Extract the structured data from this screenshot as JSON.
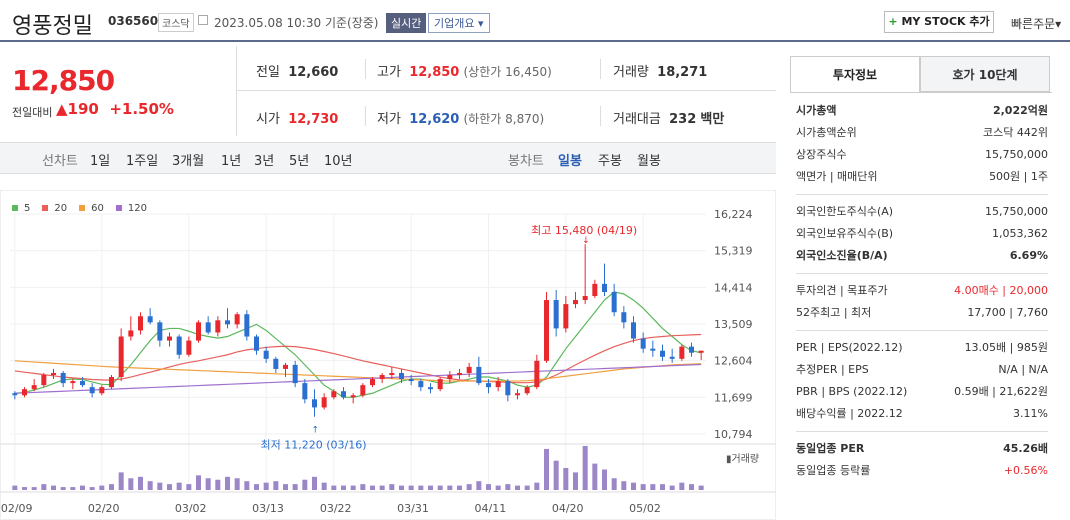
{
  "header": {
    "stock_name": "영풍정밀",
    "stock_code": "036560",
    "market_badge": "코스닥",
    "datetime": "2023.05.08 10:30",
    "basis": "기준(장중)",
    "realtime_label": "실시간",
    "company_overview": "기업개요",
    "my_stock": "MY STOCK 추가",
    "quick_order": "빠른주문"
  },
  "price": {
    "current": "12,850",
    "change_label": "전일대비",
    "change_value": "190",
    "change_pct": "+1.50%",
    "color_up": "#e8282c",
    "color_down": "#2b5fb4"
  },
  "stats": {
    "prev_label": "전일",
    "prev": "12,660",
    "high_label": "고가",
    "high": "12,850",
    "upper_limit": "(상한가 16,450)",
    "volume_label": "거래량",
    "volume": "18,271",
    "open_label": "시가",
    "open": "12,730",
    "low_label": "저가",
    "low": "12,620",
    "lower_limit": "(하한가 8,870)",
    "amount_label": "거래대금",
    "amount": "232",
    "amount_unit": "백만"
  },
  "chart_tabs": {
    "line": "선차트",
    "periods": [
      "1일",
      "1주일",
      "3개월",
      "1년",
      "3년",
      "5년",
      "10년"
    ],
    "candle": "봉차트",
    "candle_periods": [
      "일봉",
      "주봉",
      "월봉"
    ],
    "selected": "일봉"
  },
  "legend": [
    {
      "label": "5",
      "color": "#5cb85c"
    },
    {
      "label": "20",
      "color": "#e8605c"
    },
    {
      "label": "60",
      "color": "#f0a040"
    },
    {
      "label": "120",
      "color": "#a070d0"
    }
  ],
  "annotations": {
    "high": "최고 15,480 (04/19)",
    "low": "최저 11,220 (03/16)",
    "volume_label": "거래량"
  },
  "chart_data": {
    "type": "candlestick",
    "y_ticks": [
      "16,224",
      "15,319",
      "14,414",
      "13,509",
      "12,604",
      "11,699",
      "10,794"
    ],
    "ylim": [
      10794,
      16224
    ],
    "x_ticks": [
      "02/09",
      "02/20",
      "03/02",
      "03/13",
      "03/22",
      "03/31",
      "04/11",
      "04/20",
      "05/02"
    ],
    "candles": [
      [
        11800,
        11850,
        11650,
        11750
      ],
      [
        11750,
        11950,
        11700,
        11900
      ],
      [
        11900,
        12150,
        11850,
        12000
      ],
      [
        12000,
        12300,
        11950,
        12250
      ],
      [
        12250,
        12400,
        12150,
        12300
      ],
      [
        12300,
        12350,
        11950,
        12050
      ],
      [
        12050,
        12150,
        11900,
        12100
      ],
      [
        12100,
        12200,
        11950,
        12000
      ],
      [
        11950,
        12050,
        11700,
        11800
      ],
      [
        11800,
        12000,
        11750,
        11950
      ],
      [
        11950,
        12250,
        11900,
        12200
      ],
      [
        12200,
        13400,
        12100,
        13200
      ],
      [
        13200,
        13700,
        13100,
        13350
      ],
      [
        13350,
        13800,
        13250,
        13700
      ],
      [
        13700,
        13900,
        13500,
        13550
      ],
      [
        13550,
        13600,
        12950,
        13100
      ],
      [
        13100,
        13300,
        12950,
        13200
      ],
      [
        13200,
        13250,
        12650,
        12750
      ],
      [
        12750,
        13200,
        12700,
        13100
      ],
      [
        13100,
        13600,
        13050,
        13550
      ],
      [
        13550,
        13700,
        13250,
        13300
      ],
      [
        13300,
        13700,
        13200,
        13600
      ],
      [
        13600,
        13900,
        13400,
        13500
      ],
      [
        13500,
        13800,
        13400,
        13750
      ],
      [
        13750,
        13850,
        13100,
        13200
      ],
      [
        13200,
        13250,
        12750,
        12850
      ],
      [
        12850,
        12950,
        12550,
        12650
      ],
      [
        12650,
        12700,
        12300,
        12400
      ],
      [
        12400,
        12550,
        12200,
        12500
      ],
      [
        12500,
        12600,
        11950,
        12050
      ],
      [
        12050,
        12150,
        11550,
        11650
      ],
      [
        11650,
        11900,
        11220,
        11450
      ],
      [
        11450,
        11800,
        11400,
        11700
      ],
      [
        11700,
        11900,
        11650,
        11850
      ],
      [
        11850,
        11950,
        11650,
        11700
      ],
      [
        11700,
        11800,
        11550,
        11750
      ],
      [
        11750,
        12050,
        11700,
        12000
      ],
      [
        12000,
        12200,
        11950,
        12150
      ],
      [
        12150,
        12300,
        12050,
        12250
      ],
      [
        12250,
        12450,
        12150,
        12300
      ],
      [
        12300,
        12400,
        12050,
        12150
      ],
      [
        12150,
        12250,
        12000,
        12100
      ],
      [
        12100,
        12150,
        11850,
        11950
      ],
      [
        11950,
        12050,
        11800,
        11900
      ],
      [
        11900,
        12200,
        11850,
        12150
      ],
      [
        12150,
        12350,
        12050,
        12250
      ],
      [
        12250,
        12400,
        12150,
        12300
      ],
      [
        12300,
        12550,
        12200,
        12450
      ],
      [
        12450,
        12700,
        12000,
        12050
      ],
      [
        12050,
        12150,
        11800,
        11950
      ],
      [
        11950,
        12200,
        11850,
        12100
      ],
      [
        12100,
        12150,
        11600,
        11750
      ],
      [
        11750,
        11900,
        11650,
        11800
      ],
      [
        11800,
        12000,
        11750,
        11950
      ],
      [
        11950,
        12750,
        11900,
        12600
      ],
      [
        12600,
        14300,
        12550,
        14100
      ],
      [
        14100,
        14350,
        13200,
        13400
      ],
      [
        13400,
        14200,
        13300,
        14000
      ],
      [
        14000,
        14300,
        13900,
        14100
      ],
      [
        14100,
        15480,
        14000,
        14200
      ],
      [
        14200,
        14600,
        14150,
        14500
      ],
      [
        14500,
        15000,
        14200,
        14300
      ],
      [
        14300,
        14500,
        13700,
        13800
      ],
      [
        13800,
        13950,
        13400,
        13550
      ],
      [
        13550,
        13700,
        13050,
        13150
      ],
      [
        13150,
        13300,
        12800,
        12900
      ],
      [
        12900,
        13100,
        12700,
        12850
      ],
      [
        12850,
        13000,
        12600,
        12700
      ],
      [
        12700,
        12900,
        12550,
        12650
      ],
      [
        12650,
        13000,
        12600,
        12950
      ],
      [
        12950,
        13050,
        12700,
        12800
      ],
      [
        12800,
        12850,
        12620,
        12850
      ]
    ],
    "ma_lines": {
      "ma5": [
        11800,
        11820,
        11880,
        11950,
        12040,
        12130,
        12150,
        12140,
        12080,
        12020,
        12010,
        12250,
        12500,
        12800,
        13100,
        13350,
        13400,
        13400,
        13330,
        13250,
        13200,
        13160,
        13200,
        13300,
        13400,
        13500,
        13350,
        13150,
        12950,
        12750,
        12500,
        12250,
        12000,
        11850,
        11700,
        11700,
        11750,
        11800,
        11900,
        12000,
        12100,
        12150,
        12150,
        12100,
        12050,
        12050,
        12100,
        12150,
        12200,
        12200,
        12150,
        12100,
        12000,
        11950,
        12000,
        12200,
        12550,
        12900,
        13200,
        13500,
        13800,
        14100,
        14300,
        14250,
        14100,
        13900,
        13650,
        13400,
        13200,
        13000,
        12850,
        12800
      ],
      "ma20": [
        12350,
        12320,
        12290,
        12260,
        12230,
        12200,
        12180,
        12160,
        12140,
        12130,
        12120,
        12150,
        12200,
        12260,
        12320,
        12380,
        12450,
        12510,
        12560,
        12600,
        12650,
        12700,
        12750,
        12820,
        12870,
        12900,
        12930,
        12950,
        12960,
        12950,
        12920,
        12880,
        12830,
        12780,
        12720,
        12660,
        12600,
        12550,
        12500,
        12450,
        12400,
        12350,
        12300,
        12250,
        12200,
        12160,
        12130,
        12110,
        12100,
        12090,
        12080,
        12070,
        12060,
        12060,
        12080,
        12150,
        12250,
        12370,
        12500,
        12620,
        12740,
        12850,
        12950,
        13030,
        13100,
        13150,
        13180,
        13200,
        13220,
        13230,
        13240,
        13250
      ],
      "ma60": [
        12600,
        12585,
        12570,
        12555,
        12540,
        12525,
        12510,
        12495,
        12480,
        12465,
        12450,
        12440,
        12430,
        12420,
        12410,
        12400,
        12390,
        12380,
        12370,
        12360,
        12350,
        12340,
        12330,
        12320,
        12310,
        12300,
        12290,
        12280,
        12270,
        12260,
        12250,
        12240,
        12230,
        12220,
        12210,
        12200,
        12190,
        12180,
        12170,
        12160,
        12150,
        12140,
        12130,
        12120,
        12110,
        12100,
        12100,
        12100,
        12100,
        12100,
        12100,
        12100,
        12100,
        12110,
        12130,
        12160,
        12190,
        12220,
        12250,
        12280,
        12310,
        12340,
        12370,
        12400,
        12420,
        12440,
        12460,
        12480,
        12500,
        12510,
        12520,
        12530
      ],
      "ma120": [
        11800,
        11810,
        11820,
        11830,
        11840,
        11850,
        11860,
        11870,
        11880,
        11890,
        11900,
        11910,
        11920,
        11930,
        11940,
        11950,
        11960,
        11970,
        11980,
        11990,
        12000,
        12010,
        12020,
        12030,
        12040,
        12050,
        12060,
        12070,
        12080,
        12090,
        12100,
        12110,
        12120,
        12130,
        12140,
        12150,
        12160,
        12170,
        12180,
        12190,
        12200,
        12210,
        12220,
        12230,
        12240,
        12250,
        12260,
        12270,
        12280,
        12290,
        12300,
        12310,
        12320,
        12330,
        12340,
        12350,
        12360,
        12370,
        12380,
        12390,
        12400,
        12410,
        12420,
        12430,
        12440,
        12450,
        12460,
        12470,
        12480,
        12490,
        12500,
        12510
      ]
    },
    "volumes": [
      3,
      2,
      2,
      4,
      3,
      2,
      2,
      3,
      2,
      3,
      4,
      12,
      8,
      9,
      6,
      5,
      4,
      5,
      4,
      10,
      8,
      7,
      9,
      8,
      6,
      4,
      5,
      6,
      4,
      4,
      7,
      9,
      5,
      3,
      3,
      3,
      4,
      3,
      3,
      4,
      3,
      3,
      3,
      3,
      3,
      3,
      3,
      4,
      6,
      4,
      3,
      4,
      3,
      3,
      5,
      28,
      20,
      15,
      12,
      30,
      18,
      14,
      8,
      6,
      5,
      4,
      4,
      4,
      3,
      5,
      4,
      3
    ]
  },
  "panel": {
    "tab_invest": "투자정보",
    "tab_quote": "호가 10단계",
    "rows": [
      {
        "label": "시가총액",
        "value": "2,022억원",
        "bold": true
      },
      {
        "label": "시가총액순위",
        "value": "코스닥 442위"
      },
      {
        "label": "상장주식수",
        "value": "15,750,000"
      },
      {
        "label": "액면가 | 매매단위",
        "value": "500원 | 1주"
      },
      {
        "label": "외국인한도주식수(A)",
        "value": "15,750,000"
      },
      {
        "label": "외국인보유주식수(B)",
        "value": "1,053,362"
      },
      {
        "label": "외국인소진율(B/A)",
        "value": "6.69%",
        "bold": true
      },
      {
        "label": "투자의견 | 목표주가",
        "value": "4.00매수 | 20,000",
        "red": true
      },
      {
        "label": "52주최고 | 최저",
        "value": "17,700 | 7,760"
      },
      {
        "label": "PER | EPS(2022.12)",
        "value": "13.05배 | 985원"
      },
      {
        "label": "추정PER | EPS",
        "value": "N/A | N/A"
      },
      {
        "label": "PBR | BPS (2022.12)",
        "value": "0.59배 | 21,622원"
      },
      {
        "label": "배당수익률 | 2022.12",
        "value": "3.11%"
      },
      {
        "label": "동일업종 PER",
        "value": "45.26배",
        "bold": true
      },
      {
        "label": "동일업종 등락률",
        "value": "+0.56%",
        "red": true
      }
    ]
  }
}
